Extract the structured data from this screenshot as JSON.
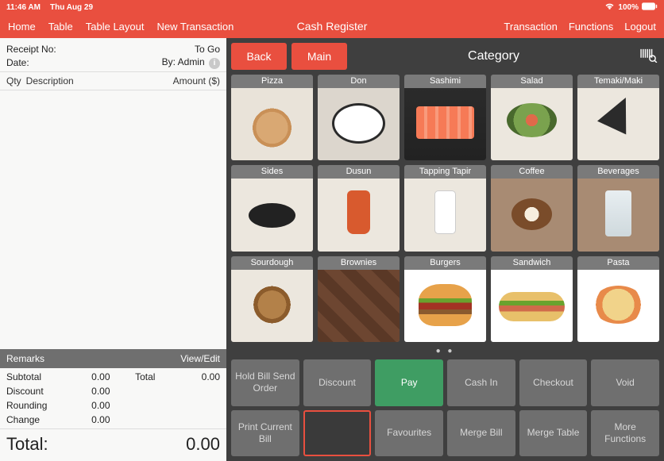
{
  "status": {
    "time": "11:46 AM",
    "date": "Thu Aug 29",
    "battery": "100%"
  },
  "menu": {
    "left": [
      "Home",
      "Table",
      "Table Layout",
      "New Transaction"
    ],
    "center": "Cash Register",
    "right": [
      "Transaction",
      "Functions",
      "Logout"
    ]
  },
  "receipt": {
    "no_label": "Receipt No:",
    "no_value": "To Go",
    "date_label": "Date:",
    "by_label": "By: Admin",
    "cols": {
      "qty": "Qty",
      "desc": "Description",
      "amount": "Amount ($)"
    },
    "remarks": {
      "label": "Remarks",
      "action": "View/Edit"
    },
    "lines": {
      "subtotal": {
        "label": "Subtotal",
        "value": "0.00"
      },
      "discount": {
        "label": "Discount",
        "value": "0.00"
      },
      "rounding": {
        "label": "Rounding",
        "value": "0.00"
      },
      "change": {
        "label": "Change",
        "value": "0.00"
      },
      "total_side": {
        "label": "Total",
        "value": "0.00"
      }
    },
    "grand": {
      "label": "Total:",
      "value": "0.00"
    }
  },
  "right": {
    "back": "Back",
    "main": "Main",
    "title": "Category",
    "categories": [
      "Pizza",
      "Don",
      "Sashimi",
      "Salad",
      "Temaki/Maki",
      "Sides",
      "Dusun",
      "Tapping Tapir",
      "Coffee",
      "Beverages",
      "Sourdough",
      "Brownies",
      "Burgers",
      "Sandwich",
      "Pasta"
    ],
    "thumb_classes": [
      "pizza",
      "don",
      "sashimi",
      "salad",
      "temaki",
      "sides",
      "dusun",
      "tapir",
      "coffee",
      "bev",
      "sour",
      "brown",
      "burger",
      "sand",
      "pasta"
    ],
    "fn": [
      "Hold Bill Send Order",
      "Discount",
      "Pay",
      "Cash In",
      "Checkout",
      "Void",
      "Print Current Bill",
      "",
      "Favourites",
      "Merge Bill",
      "Merge Table",
      "More Functions"
    ]
  }
}
